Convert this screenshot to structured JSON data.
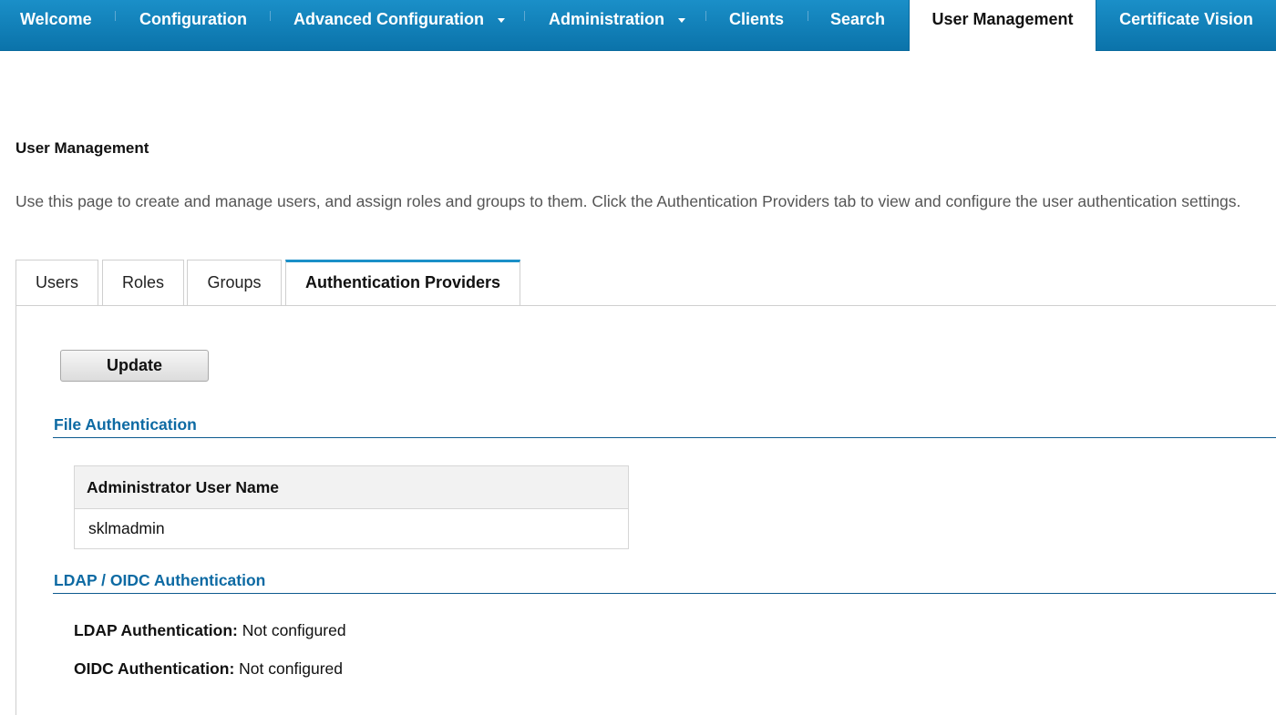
{
  "nav": {
    "items": [
      {
        "label": "Welcome"
      },
      {
        "label": "Configuration"
      },
      {
        "label": "Advanced Configuration"
      },
      {
        "label": "Administration"
      },
      {
        "label": "Clients"
      },
      {
        "label": "Search"
      },
      {
        "label": "User Management"
      },
      {
        "label": "Certificate Vision"
      }
    ],
    "active": "User Management",
    "colors": {
      "bar": "#0b73aa",
      "active_bg": "#ffffff"
    }
  },
  "page": {
    "title": "User Management",
    "description": "Use this page to create and manage users, and assign roles and groups to them. Click the Authentication Providers tab to view and configure the user authentication settings."
  },
  "tabs": [
    {
      "label": "Users"
    },
    {
      "label": "Roles"
    },
    {
      "label": "Groups"
    },
    {
      "label": "Authentication Providers"
    }
  ],
  "active_tab": "Authentication Providers",
  "panel": {
    "update_label": "Update",
    "file_auth": {
      "title": "File Authentication",
      "table_header": "Administrator User Name",
      "rows": [
        "sklmadmin"
      ]
    },
    "ldap_oidc": {
      "title": "LDAP / OIDC Authentication",
      "ldap_label": "LDAP Authentication:",
      "ldap_value": "Not configured",
      "oidc_label": "OIDC Authentication:",
      "oidc_value": "Not configured"
    }
  },
  "colors": {
    "accent": "#1a8fc8",
    "section_title": "#0d6aa3"
  }
}
